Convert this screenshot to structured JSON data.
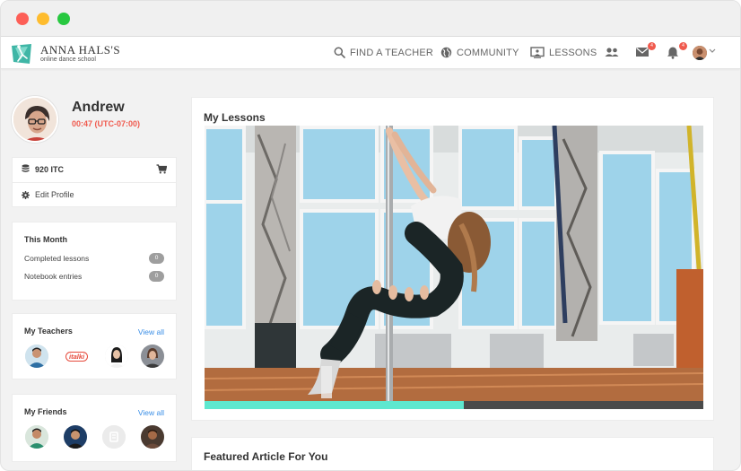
{
  "brand": {
    "name": "ANNA HALS'S",
    "tagline": "online dance school",
    "accent": "#3fb6a6"
  },
  "nav": {
    "items": [
      {
        "label": "FIND A TEACHER",
        "icon": "search-icon"
      },
      {
        "label": "COMMUNITY",
        "icon": "globe-icon"
      },
      {
        "label": "LESSONS",
        "icon": "lessons-icon"
      }
    ],
    "icons": {
      "people": "people-icon",
      "messages_badge": "4",
      "notifications_badge": "4"
    }
  },
  "profile": {
    "name": "Andrew",
    "time": "00:47 (UTC-07:00)",
    "itc": "920 ITC",
    "edit_label": "Edit Profile"
  },
  "this_month": {
    "title": "This Month",
    "stats": [
      {
        "label": "Completed lessons",
        "value": "0"
      },
      {
        "label": "Notebook entries",
        "value": "0"
      }
    ]
  },
  "teachers": {
    "title": "My Teachers",
    "view_all": "View all",
    "italki_label": "italki"
  },
  "friends": {
    "title": "My Friends",
    "view_all": "View all"
  },
  "lessons": {
    "title": "My Lessons",
    "progress": 0.52
  },
  "article": {
    "title": "Featured Article For You"
  },
  "colors": {
    "time_red": "#f05a4e",
    "link_blue": "#3a8ee6",
    "progress_fill": "#5ee8cf"
  }
}
